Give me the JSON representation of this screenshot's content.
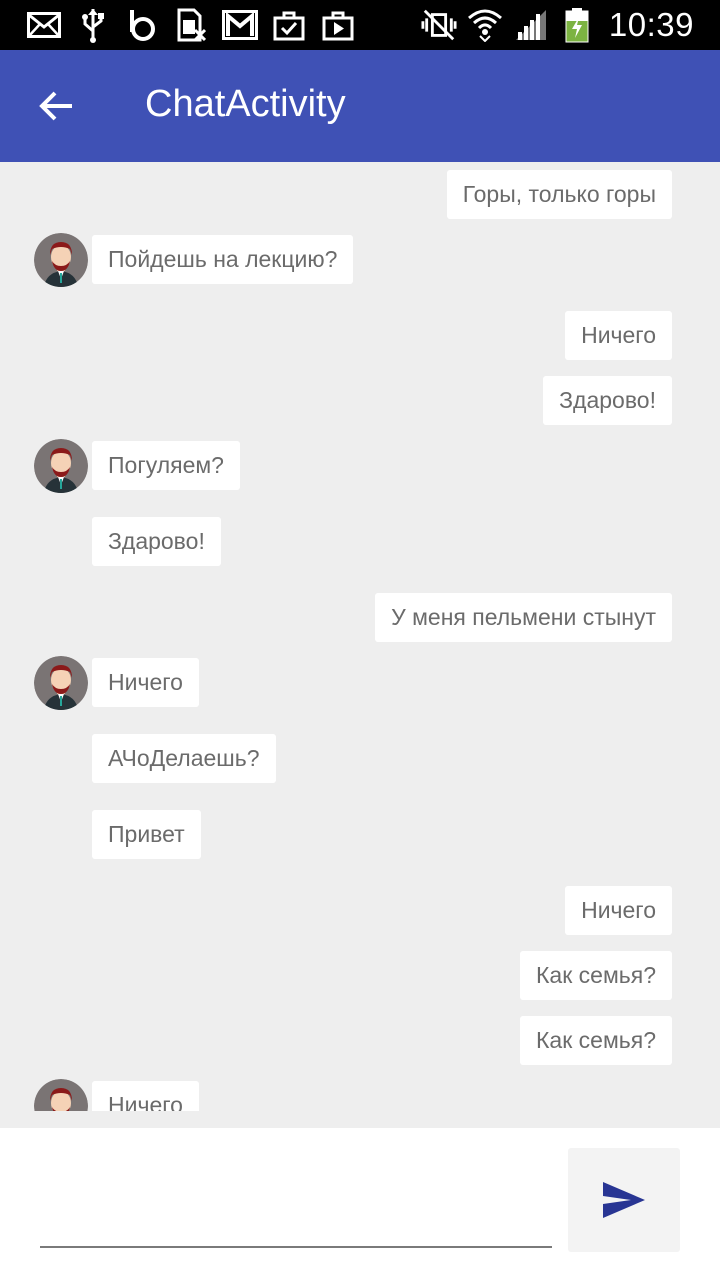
{
  "status_bar": {
    "time": "10:39",
    "left_icons": [
      "mail-icon",
      "usb-icon",
      "b-app-icon",
      "sim-card-icon",
      "gmail-icon",
      "shopping-bag-icon",
      "play-store-icon"
    ],
    "right_icons": [
      "no-vibrate-icon",
      "wifi-icon",
      "signal-icon",
      "battery-charging-icon"
    ],
    "battery_color": "#7cb342"
  },
  "app_bar": {
    "title": "ChatActivity",
    "color": "#3f51b5"
  },
  "messages": [
    {
      "side": "out",
      "text": "Горы, только горы"
    },
    {
      "side": "in",
      "avatar": true,
      "text": "Пойдешь на лекцию?"
    },
    {
      "side": "out",
      "text": "Ничего"
    },
    {
      "side": "out",
      "text": "Здарово!"
    },
    {
      "side": "in",
      "avatar": true,
      "text": "Погуляем?"
    },
    {
      "side": "in",
      "avatar": false,
      "text": "Здарово!"
    },
    {
      "side": "out",
      "text": "У меня пельмени стынут"
    },
    {
      "side": "in",
      "avatar": true,
      "text": "Ничего"
    },
    {
      "side": "in",
      "avatar": false,
      "text": "АЧоДелаешь?"
    },
    {
      "side": "in",
      "avatar": false,
      "text": "Привет"
    },
    {
      "side": "out",
      "text": "Ничего"
    },
    {
      "side": "out",
      "text": "Как семья?"
    },
    {
      "side": "out",
      "text": "Как семья?"
    },
    {
      "side": "in",
      "avatar": true,
      "text": "Ничего"
    }
  ],
  "composer": {
    "value": "",
    "send_icon": "send-icon",
    "accent": "#283593"
  }
}
